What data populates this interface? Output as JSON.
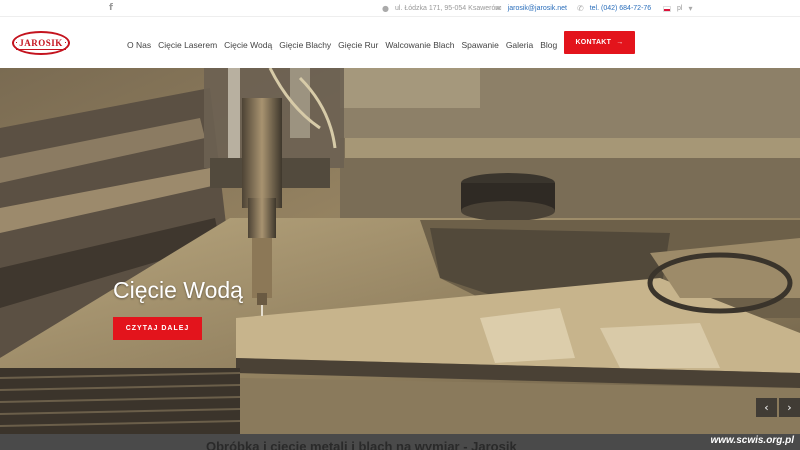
{
  "topbar": {
    "facebook_icon": "f",
    "address": "ul. Łódzka 171, 95-054 Ksawerów",
    "email": "jarosik@jarosik.net",
    "phone": "tel. (042) 684-72-76",
    "lang": "pl"
  },
  "header": {
    "logo_text": "JAROSIK",
    "nav": [
      "O Nas",
      "Cięcie Laserem",
      "Cięcie Wodą",
      "Gięcie Blachy",
      "Gięcie Rur",
      "Walcowanie Blach",
      "Spawanie",
      "Galeria",
      "Blog"
    ],
    "cta_label": "KONTAKT",
    "cta_icon": "→"
  },
  "hero": {
    "title": "Cięcie Wodą",
    "button_label": "CZYTAJ DALEJ",
    "prev_icon": "‹",
    "next_icon": "›"
  },
  "bottom": {
    "heading": "Obróbka i cięcie metali i blach na wymiar - Jarosik",
    "watermark": "www.scwis.org.pl"
  },
  "colors": {
    "accent": "#e3141c",
    "link": "#2a6ebb"
  }
}
